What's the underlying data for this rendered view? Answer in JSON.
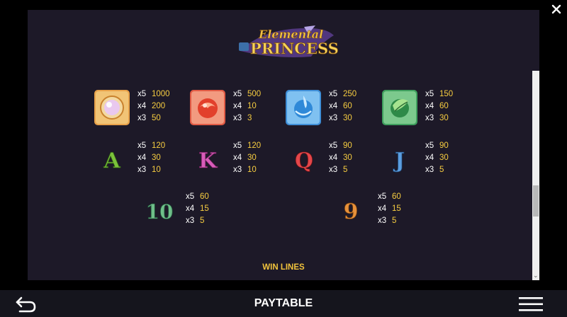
{
  "logo": {
    "word1": "Elemental",
    "word2": "PRINCESS"
  },
  "symbols": {
    "pearl": {
      "icon": "pearl-icon",
      "pays": [
        {
          "m": "x5",
          "v": "1000"
        },
        {
          "m": "x4",
          "v": "200"
        },
        {
          "m": "x3",
          "v": "50"
        }
      ]
    },
    "fire": {
      "icon": "fire-orb-icon",
      "pays": [
        {
          "m": "x5",
          "v": "500"
        },
        {
          "m": "x4",
          "v": "10"
        },
        {
          "m": "x3",
          "v": "3"
        }
      ]
    },
    "water": {
      "icon": "water-orb-icon",
      "pays": [
        {
          "m": "x5",
          "v": "250"
        },
        {
          "m": "x4",
          "v": "60"
        },
        {
          "m": "x3",
          "v": "30"
        }
      ]
    },
    "earth": {
      "icon": "leaf-orb-icon",
      "pays": [
        {
          "m": "x5",
          "v": "150"
        },
        {
          "m": "x4",
          "v": "60"
        },
        {
          "m": "x3",
          "v": "30"
        }
      ]
    },
    "A": {
      "glyph": "A",
      "color": "#7bc23a",
      "pays": [
        {
          "m": "x5",
          "v": "120"
        },
        {
          "m": "x4",
          "v": "30"
        },
        {
          "m": "x3",
          "v": "10"
        }
      ]
    },
    "K": {
      "glyph": "K",
      "color": "#d75cb9",
      "pays": [
        {
          "m": "x5",
          "v": "120"
        },
        {
          "m": "x4",
          "v": "30"
        },
        {
          "m": "x3",
          "v": "10"
        }
      ]
    },
    "Q": {
      "glyph": "Q",
      "color": "#e4474b",
      "pays": [
        {
          "m": "x5",
          "v": "90"
        },
        {
          "m": "x4",
          "v": "30"
        },
        {
          "m": "x3",
          "v": "5"
        }
      ]
    },
    "J": {
      "glyph": "J",
      "color": "#5b9ee0",
      "pays": [
        {
          "m": "x5",
          "v": "90"
        },
        {
          "m": "x4",
          "v": "30"
        },
        {
          "m": "x3",
          "v": "5"
        }
      ]
    },
    "ten": {
      "glyph": "10",
      "color": "#6fbf8a",
      "pays": [
        {
          "m": "x5",
          "v": "60"
        },
        {
          "m": "x4",
          "v": "15"
        },
        {
          "m": "x3",
          "v": "5"
        }
      ]
    },
    "nine": {
      "glyph": "9",
      "color": "#e7913a",
      "pays": [
        {
          "m": "x5",
          "v": "60"
        },
        {
          "m": "x4",
          "v": "15"
        },
        {
          "m": "x3",
          "v": "5"
        }
      ]
    }
  },
  "section_heading": "WIN LINES",
  "bottom_bar": {
    "title": "PAYTABLE",
    "back_icon": "back-arrow-icon",
    "menu_icon": "hamburger-menu-icon"
  },
  "close_icon": "close-icon"
}
